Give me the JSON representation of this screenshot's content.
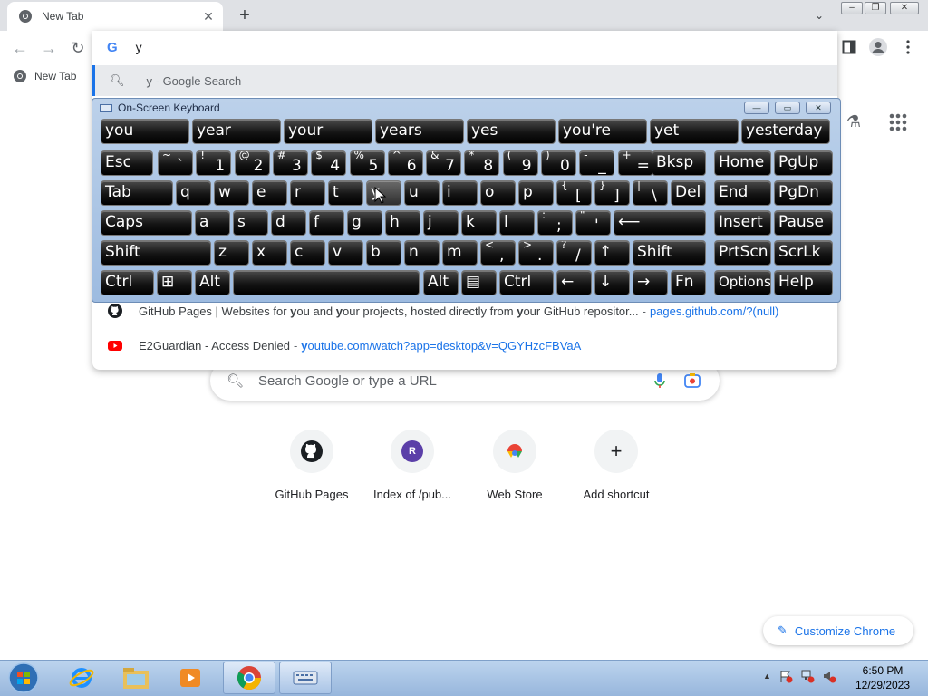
{
  "browser": {
    "tab_title": "New Tab",
    "tab_close": "✕",
    "new_tab": "+",
    "tab_search": "⌄",
    "win_min": "‒",
    "win_max": "❐",
    "win_close": "✕"
  },
  "toolbar": {
    "back": "←",
    "forward": "→",
    "reload": "↻",
    "omnibox_text": "y",
    "google_g": "G"
  },
  "bookmarks": {
    "new_tab_label": "New Tab"
  },
  "omnibox_dropdown": {
    "search_suggestion": "y - Google Search",
    "suggestions": [
      {
        "title_parts": [
          "GitHub Pages | Websites for ",
          "y",
          "ou and ",
          "y",
          "our projects, hosted directly from ",
          "y",
          "our GitHub repositor..."
        ],
        "sep": "-",
        "url": "pages.github.com/?(null)"
      },
      {
        "title": "E2Guardian - Access Denied",
        "sep": "-",
        "url_bold": "y",
        "url": "outube.com/watch?app=desktop&v=QGYHzcFBVaA"
      }
    ]
  },
  "osk": {
    "title": "On-Screen Keyboard",
    "btn_min": "—",
    "btn_max": "▭",
    "btn_close": "✕",
    "predictions": [
      "you",
      "year",
      "your",
      "years",
      "yes",
      "you're",
      "yet",
      "yesterday"
    ],
    "keys": {
      "esc": "Esc",
      "bksp": "Bksp",
      "home": "Home",
      "pgup": "PgUp",
      "tab": "Tab",
      "del": "Del",
      "end": "End",
      "pgdn": "PgDn",
      "caps": "Caps",
      "insert": "Insert",
      "pause": "Pause",
      "shift": "Shift",
      "prtscn": "PrtScn",
      "scrlk": "ScrLk",
      "ctrl": "Ctrl",
      "alt": "Alt",
      "fn": "Fn",
      "options": "Options",
      "help": "Help",
      "enter": "⟵"
    },
    "row1": [
      [
        "~",
        "`"
      ],
      [
        "!",
        "1"
      ],
      [
        "@",
        "2"
      ],
      [
        "#",
        "3"
      ],
      [
        "$",
        "4"
      ],
      [
        "%",
        "5"
      ],
      [
        "^",
        "6"
      ],
      [
        "&",
        "7"
      ],
      [
        "*",
        "8"
      ],
      [
        "(",
        "9"
      ],
      [
        ")",
        "0"
      ],
      [
        "-",
        "_"
      ],
      [
        "+",
        "="
      ]
    ],
    "row2": [
      "q",
      "w",
      "e",
      "r",
      "t",
      "y",
      "u",
      "i",
      "o",
      "p"
    ],
    "row2_sym": [
      [
        "{",
        "["
      ],
      [
        "}",
        "]"
      ],
      [
        "|",
        "\\"
      ]
    ],
    "row3": [
      "a",
      "s",
      "d",
      "f",
      "g",
      "h",
      "j",
      "k",
      "l"
    ],
    "row3_sym": [
      [
        ":",
        ";"
      ],
      [
        "\"",
        "'"
      ]
    ],
    "row4": [
      "z",
      "x",
      "c",
      "v",
      "b",
      "n",
      "m"
    ],
    "row4_sym": [
      [
        "<",
        ","
      ],
      [
        ">",
        "."
      ],
      [
        "?",
        "/"
      ]
    ],
    "row4_arrow_up": "↑",
    "row5_arrows": [
      "←",
      "↓",
      "→"
    ],
    "win_key": "⊞",
    "menu_key": "▤"
  },
  "ntp": {
    "search_placeholder": "Search Google or type a URL",
    "shortcuts": [
      {
        "label": "GitHub Pages",
        "glyph": ""
      },
      {
        "label": "Index of /pub...",
        "glyph": "R"
      },
      {
        "label": "Web Store",
        "glyph": ""
      },
      {
        "label": "Add shortcut",
        "glyph": "+"
      }
    ],
    "customize": "Customize Chrome"
  },
  "taskbar": {
    "time": "6:50 PM",
    "date": "12/29/2023",
    "tray_arrow": "▲"
  },
  "colors": {
    "accent": "#1a73e8",
    "tabstrip": "#dfe1e5",
    "taskbar": "#a9c4e6"
  }
}
